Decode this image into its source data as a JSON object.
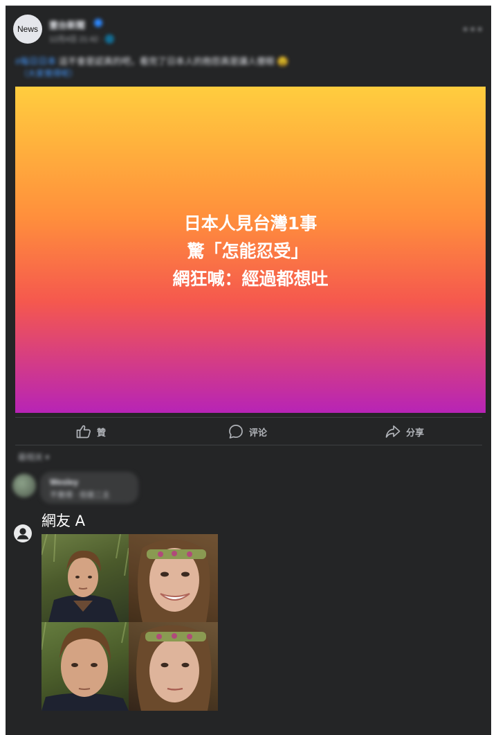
{
  "post": {
    "avatar_text": "News",
    "page_name": "壹台新聞",
    "meta": "12月4日 21:42 · 🌐",
    "more_icon": "more-horizontal-icon",
    "caption_link": "#每日日本",
    "caption_text": " 這不會是認真的吧，看完了日本人的抱怨真是讓人傻眼 😵",
    "caption_link2": "（大家覺得呢）"
  },
  "image": {
    "headline_lines": [
      "日本人見台灣1事",
      "驚「怎能忍受」",
      "網狂喊：經過都想吐"
    ],
    "gradient_colors": [
      "#ffcd3e",
      "#ff8f3c",
      "#f5584e",
      "#b724b6"
    ]
  },
  "actions": {
    "like": "贊",
    "comment": "评论",
    "share": "分享"
  },
  "comments": {
    "sort_label": "最相关 ▾",
    "first": {
      "name": "Wesley",
      "text": "不覺得 · 但是二主"
    },
    "second": {
      "name": "網友 A"
    }
  },
  "colors": {
    "card_bg": "#242526",
    "text_primary": "#e4e6eb",
    "text_secondary": "#b0b3b8",
    "link": "#4599ff"
  }
}
